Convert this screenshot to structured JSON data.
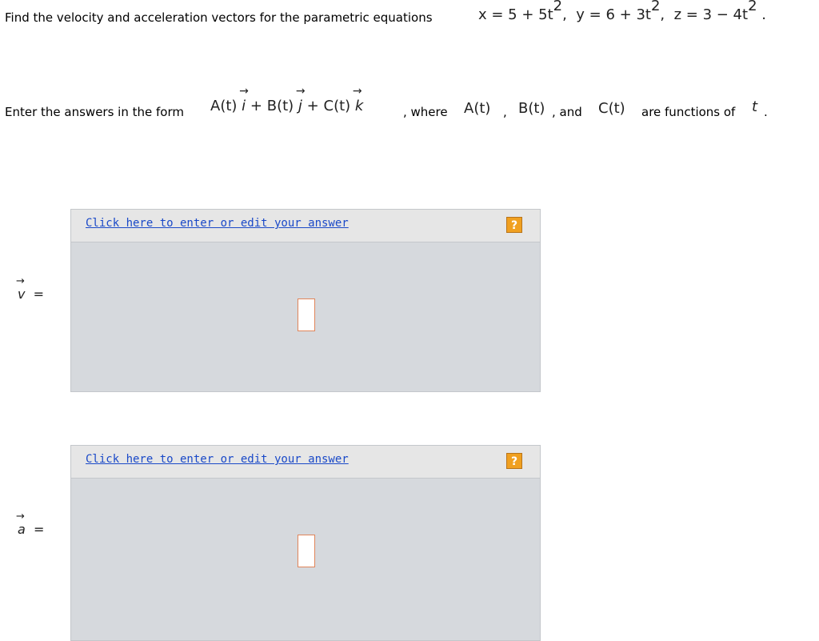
{
  "problem": {
    "intro": "Find the velocity and acceleration vectors for the parametric equations",
    "eq_x": "x = 5 + 5t",
    "eq_y": "y = 6 + 3t",
    "eq_z": "z = 3 − 4t",
    "exponent": "2",
    "end_period": "."
  },
  "instructions": {
    "prefix": "Enter the answers in the form",
    "A": "A(t)",
    "B": "B(t)",
    "C": "C(t)",
    "i": "i",
    "j": "j",
    "k": "k",
    "plus": "+",
    "where": ", where",
    "comma": ",",
    "and": ", and",
    "suffix": "are functions of",
    "t": "t",
    "period": "."
  },
  "answers": [
    {
      "symbol": "v",
      "equals": "=",
      "link_label": "Click here to enter or edit your answer",
      "help_label": "?"
    },
    {
      "symbol": "a",
      "equals": "=",
      "link_label": "Click here to enter or edit your answer",
      "help_label": "?"
    }
  ],
  "colors": {
    "link": "#1a49c8",
    "help": "#f0a020",
    "panel": "#d6d9dd",
    "slot_border": "#e0855a"
  }
}
